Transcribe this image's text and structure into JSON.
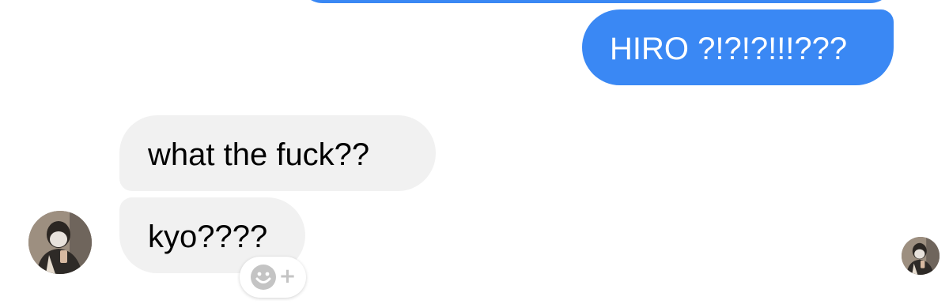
{
  "messages": [
    {
      "direction": "sent",
      "text": ""
    },
    {
      "direction": "sent",
      "text": "HIRO ?!?!?!!!???"
    },
    {
      "direction": "received",
      "text": "what the fuck??"
    },
    {
      "direction": "received",
      "text": "kyo????"
    }
  ],
  "icons": {
    "reaction": "smiley-add-icon",
    "avatar_left": "contact-avatar",
    "avatar_right": "read-receipt-avatar"
  },
  "colors": {
    "sent_bubble": "#3a88f4",
    "received_bubble": "#f1f1f1",
    "background": "#ffffff"
  }
}
